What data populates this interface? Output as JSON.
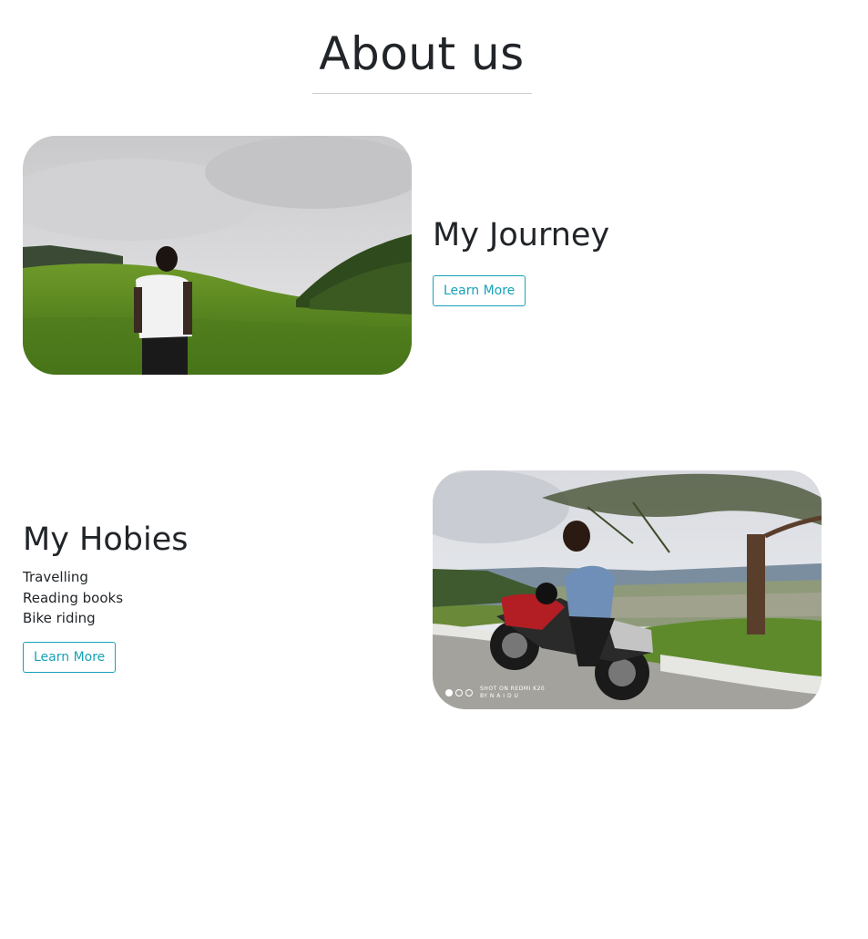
{
  "page": {
    "title": "About us"
  },
  "journey": {
    "heading": "My Journey",
    "button_label": "Learn More"
  },
  "hobbies": {
    "heading": "My Hobies",
    "items": [
      "Travelling",
      "Reading books",
      "Bike riding"
    ],
    "button_label": "Learn More"
  },
  "bike_photo": {
    "watermark_line1": "SHOT ON REDMI K20",
    "watermark_line2": "BY N A I D U"
  },
  "colors": {
    "accent": "#17a2b8",
    "text": "#212529",
    "divider": "#cfcfcf"
  }
}
